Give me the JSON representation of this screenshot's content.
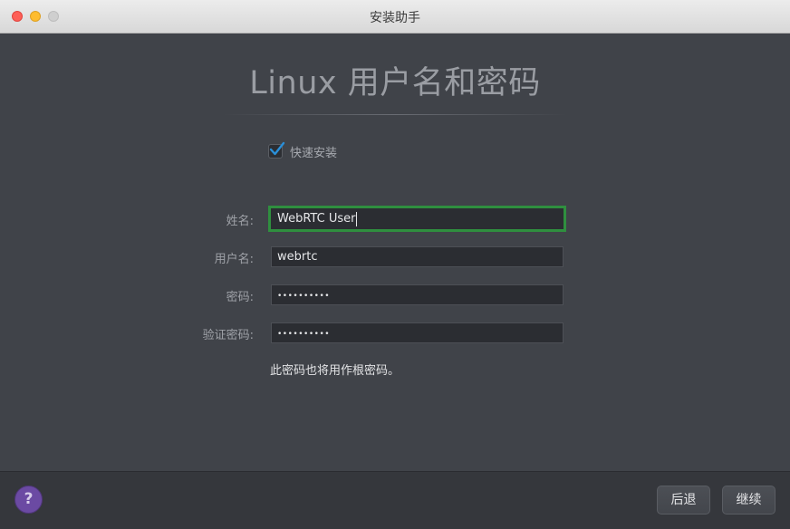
{
  "window": {
    "title": "安装助手"
  },
  "heading": "Linux 用户名和密码",
  "quick_install": {
    "label": "快速安装",
    "checked": true
  },
  "form": {
    "full_name": {
      "label": "姓名:",
      "value": "WebRTC User"
    },
    "username": {
      "label": "用户名:",
      "value": "webrtc"
    },
    "password": {
      "label": "密码:",
      "value": "••••••••••"
    },
    "confirm_password": {
      "label": "验证密码:",
      "value": "••••••••••"
    }
  },
  "note": "此密码也将用作根密码。",
  "footer": {
    "help_label": "?",
    "back_label": "后退",
    "continue_label": "继续"
  },
  "colors": {
    "focus_ring": "#2f8f3f",
    "checkmark": "#2a8fd8",
    "help": "#6b4aa3"
  }
}
